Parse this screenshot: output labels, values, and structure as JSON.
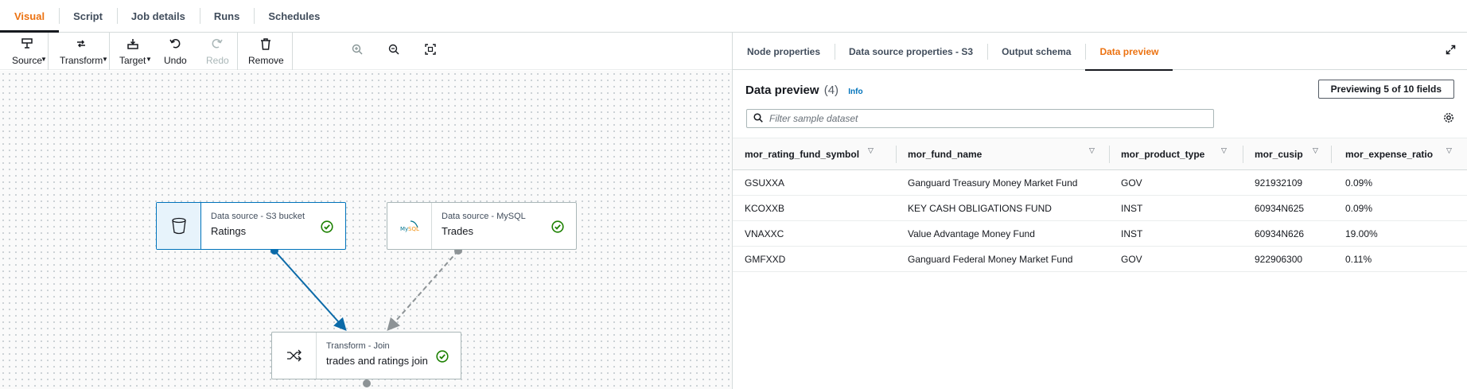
{
  "top_tabs": [
    {
      "label": "Visual",
      "active": true
    },
    {
      "label": "Script"
    },
    {
      "label": "Job details"
    },
    {
      "label": "Runs"
    },
    {
      "label": "Schedules"
    }
  ],
  "toolbar": {
    "source": "Source",
    "transform": "Transform",
    "target": "Target",
    "undo": "Undo",
    "redo": "Redo",
    "remove": "Remove"
  },
  "nodes": {
    "ratings": {
      "type": "Data source - S3 bucket",
      "name": "Ratings",
      "icon": "bucket-icon"
    },
    "trades": {
      "type": "Data source - MySQL",
      "name": "Trades",
      "icon": "mysql-logo"
    },
    "join": {
      "type": "Transform - Join",
      "name": "trades and ratings join",
      "icon": "shuffle-icon"
    }
  },
  "right_tabs": [
    {
      "label": "Node properties"
    },
    {
      "label": "Data source properties - S3"
    },
    {
      "label": "Output schema"
    },
    {
      "label": "Data preview",
      "active": true
    }
  ],
  "preview": {
    "title": "Data preview",
    "count": "(4)",
    "info": "Info",
    "previewing": "Previewing 5 of 10 fields",
    "filter_placeholder": "Filter sample dataset"
  },
  "table": {
    "columns": [
      "mor_rating_fund_symbol",
      "mor_fund_name",
      "mor_product_type",
      "mor_cusip",
      "mor_expense_ratio"
    ],
    "rows": [
      [
        "GSUXXA",
        "Ganguard Treasury Money Market Fund",
        "GOV",
        "921932109",
        "0.09%"
      ],
      [
        "KCOXXB",
        "KEY CASH OBLIGATIONS FUND",
        "INST",
        "60934N625",
        "0.09%"
      ],
      [
        "VNAXXC",
        "Value Advantage Money Fund",
        "INST",
        "60934N626",
        "19.00%"
      ],
      [
        "GMFXXD",
        "Ganguard Federal Money Market Fund",
        "GOV",
        "922906300",
        "0.11%"
      ]
    ]
  },
  "colors": {
    "accent": "#ec7211",
    "link": "#0073bb",
    "success": "#1d8102",
    "edge_active": "#0b6aa8",
    "edge_pending": "#8d9396"
  }
}
